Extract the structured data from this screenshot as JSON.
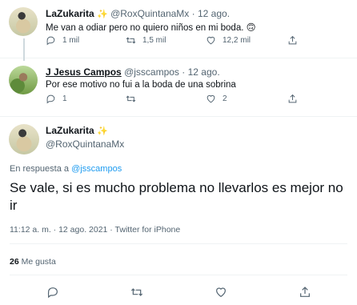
{
  "tweet1": {
    "name": "LaZukarita",
    "handle": "@RoxQuintanaMx",
    "time": "· 12 ago.",
    "text": "Me van a odiar pero no quiero niños en mi boda. 🙃",
    "replies": "1 mil",
    "retweets": "1,5 mil",
    "likes": "12,2 mil"
  },
  "tweet2": {
    "name": "J Jesus Campos",
    "handle": "@jsscampos",
    "time": "· 12 ago.",
    "text": "Por ese motivo no fui a la boda de una sobrina",
    "replies": "1",
    "retweets": "",
    "likes": "2"
  },
  "main": {
    "name": "LaZukarita",
    "handle": "@RoxQuintanaMx",
    "reply_prefix": "En respuesta a",
    "reply_handle": "@jsscampos",
    "text": "Se vale, si es mucho problema no llevarlos es mejor no ir",
    "timestamp": "11:12 a. m. · 12 ago. 2021 · Twitter for iPhone",
    "like_count": "26",
    "like_label": "Me gusta"
  },
  "icons": {
    "reply": "reply-icon",
    "retweet": "retweet-icon",
    "like": "heart-icon",
    "share": "share-icon",
    "sparkles": "sparkles-icon"
  },
  "colors": {
    "link": "#1d9bf0",
    "secondary": "#536471",
    "sparkle": "#f4b400"
  }
}
